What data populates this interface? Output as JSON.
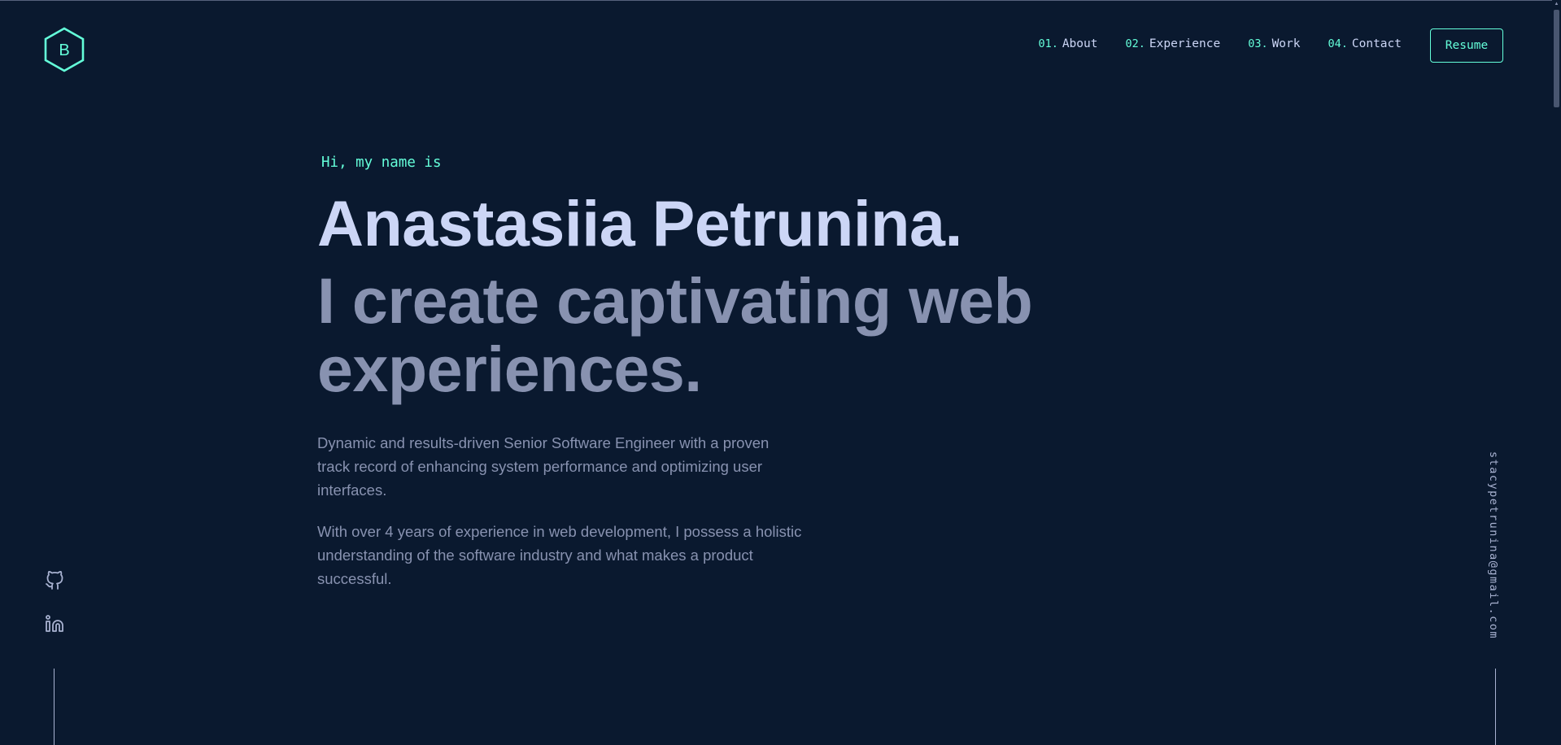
{
  "header": {
    "logo_letter": "B",
    "nav": [
      {
        "num": "01.",
        "label": "About"
      },
      {
        "num": "02.",
        "label": "Experience"
      },
      {
        "num": "03.",
        "label": "Work"
      },
      {
        "num": "04.",
        "label": "Contact"
      }
    ],
    "resume_label": "Resume"
  },
  "hero": {
    "greeting": "Hi, my name is",
    "name": "Anastasiia Petrunina.",
    "tagline": "I create captivating web experiences.",
    "bio": [
      "Dynamic and results-driven Senior Software Engineer with a proven track record of enhancing system performance and optimizing user interfaces.",
      "With over 4 years of experience in web development, I possess a holistic understanding of the software industry and what makes a product successful."
    ]
  },
  "social": {
    "icons": [
      "github-icon",
      "linkedin-icon"
    ]
  },
  "email": "stacypetrunina@gmail.com",
  "colors": {
    "background": "#0a192f",
    "accent": "#64ffda",
    "light_slate": "#ccd6f6",
    "slate": "#8892b0"
  }
}
